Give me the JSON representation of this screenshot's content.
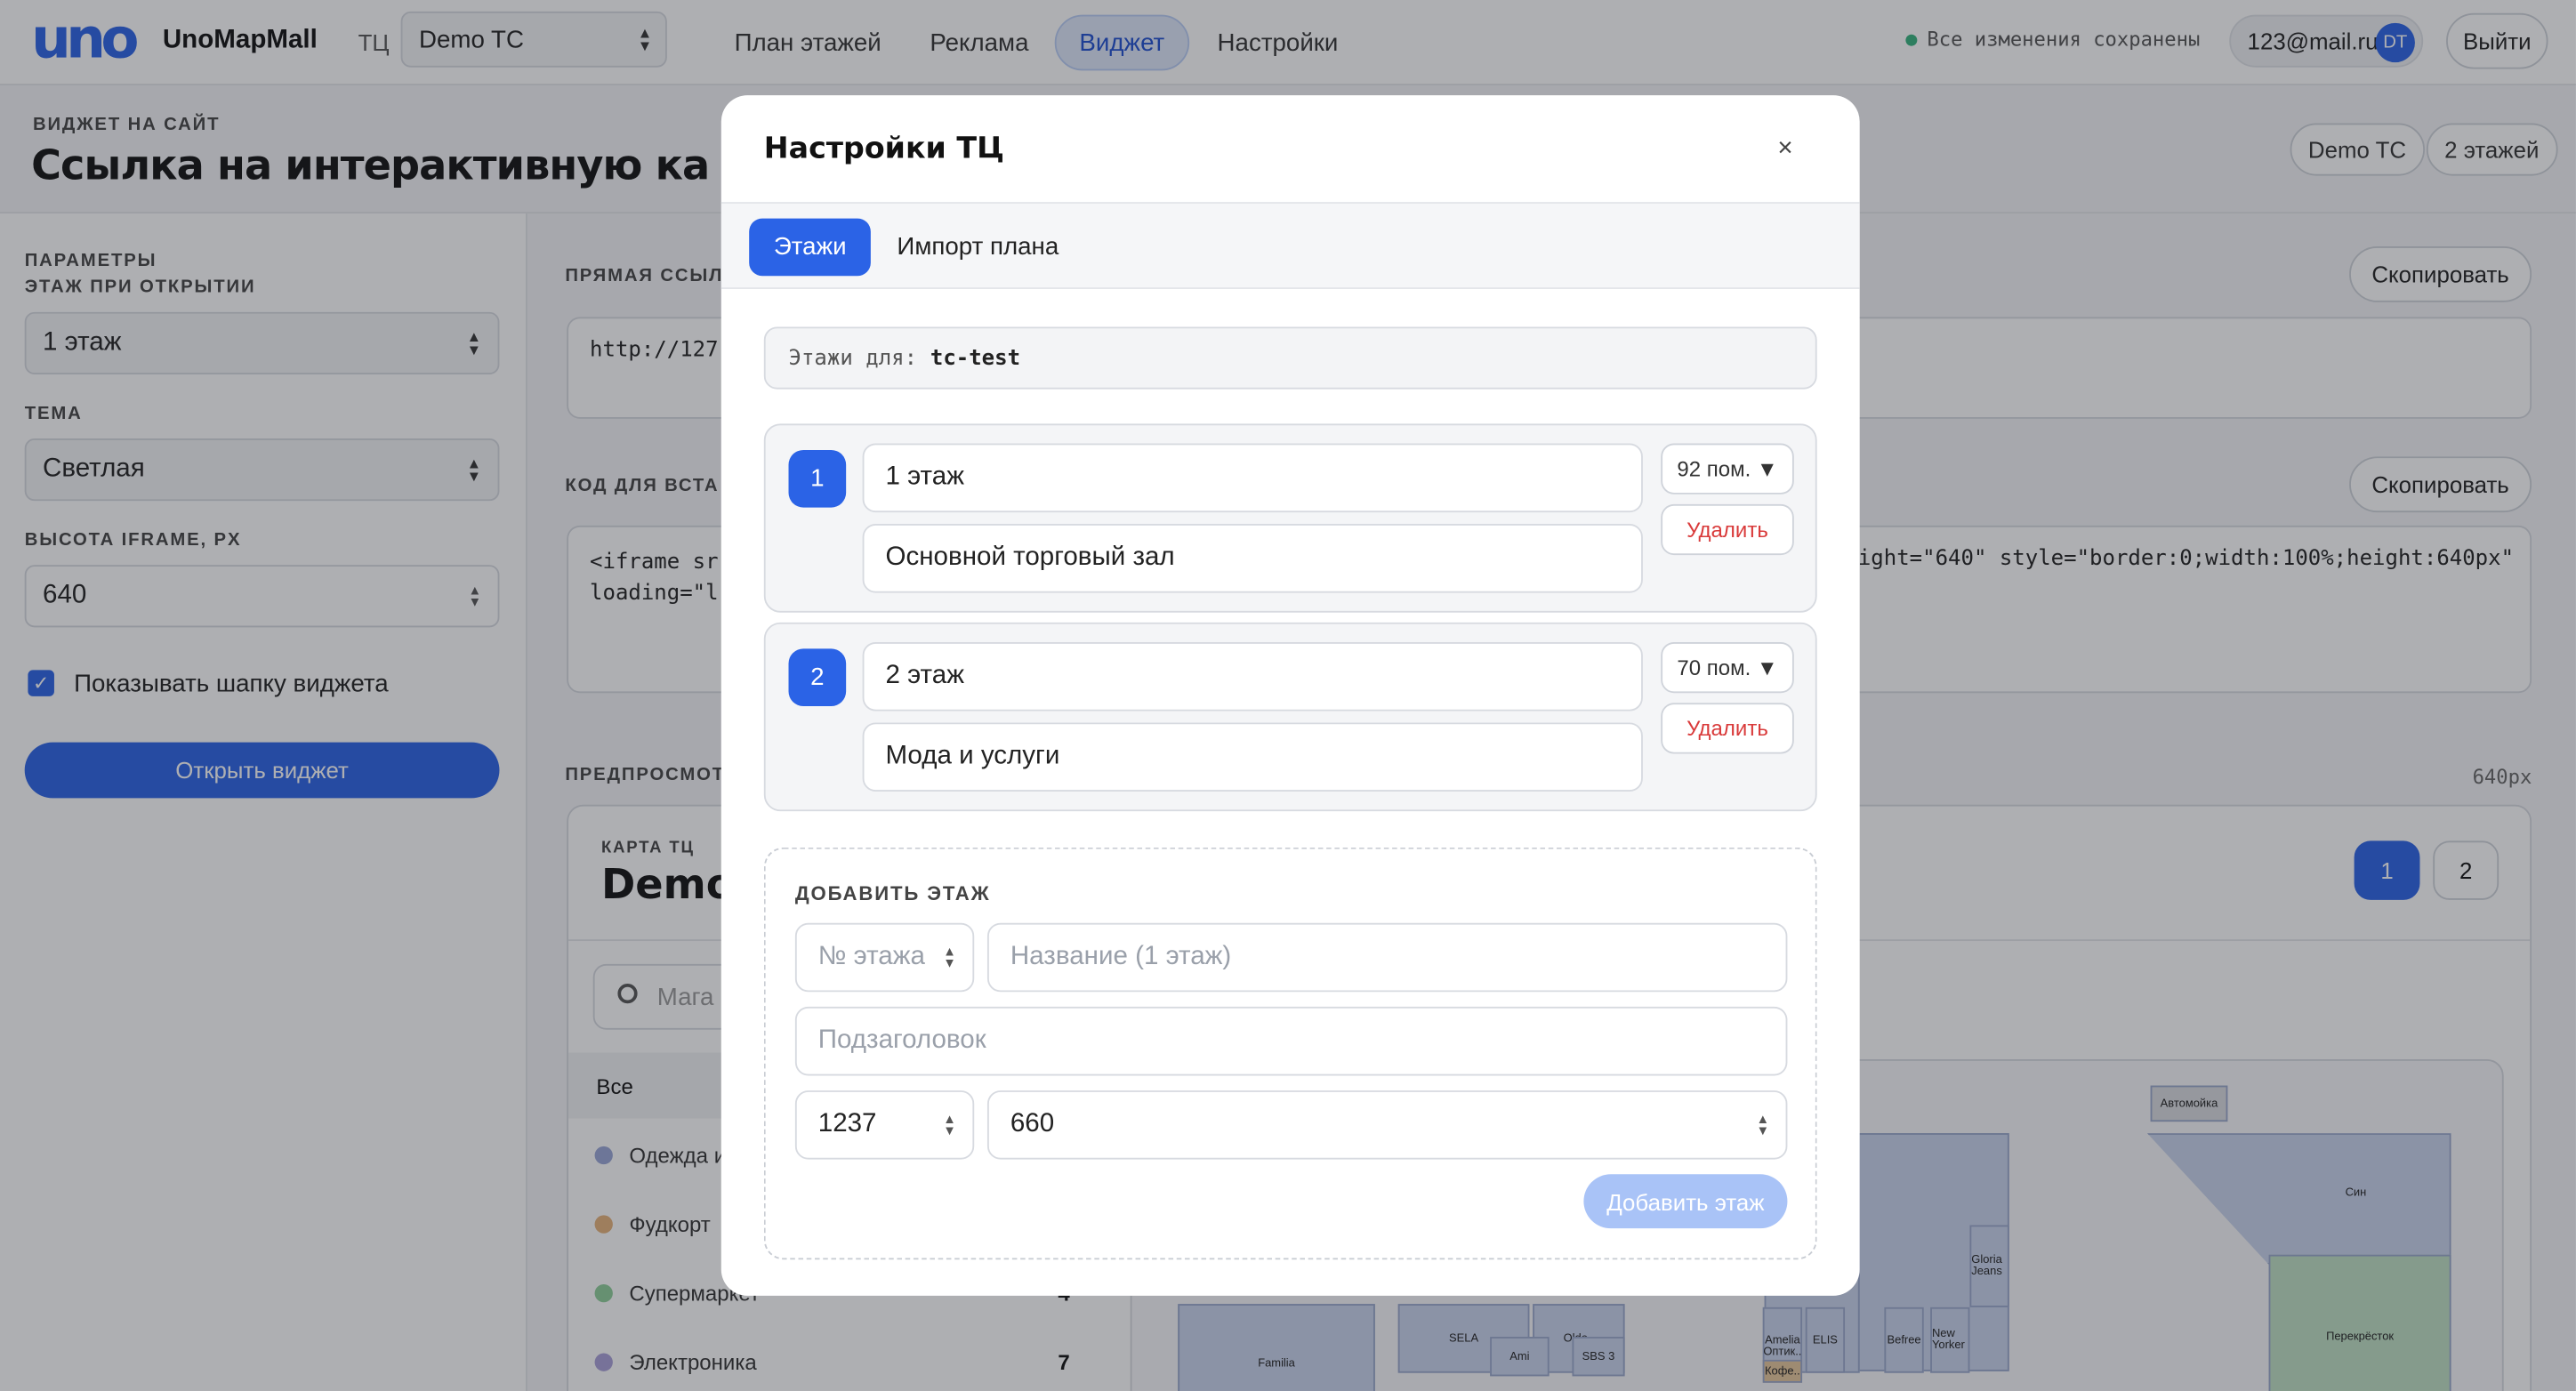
{
  "app": {
    "logo": "uno",
    "name": "UnoMapMall"
  },
  "topbar": {
    "tc_label": "ТЦ",
    "tc_select": "Demo TC",
    "nav": [
      "План этажей",
      "Реклама",
      "Виджет",
      "Настройки"
    ],
    "active_nav": "Виджет",
    "saved_status": "Все изменения сохранены",
    "user_email": "123@mail.ru",
    "avatar_initials": "DT",
    "logout": "Выйти"
  },
  "header": {
    "eyebrow": "ВИДЖЕТ НА САЙТ",
    "title": "Ссылка на интерактивную ка",
    "chip_tc": "Demo TC",
    "chip_floors": "2 этажей"
  },
  "params": {
    "section": "ПАРАМЕТРЫ",
    "floor_label": "ЭТАЖ ПРИ ОТКРЫТИИ",
    "floor_value": "1 этаж",
    "theme_label": "ТЕМА",
    "theme_value": "Светлая",
    "height_label": "ВЫСОТА IFRAME, PX",
    "height_value": "640",
    "show_header_label": "Показывать шапку виджета",
    "show_header_checked": true,
    "open_widget": "Открыть виджет"
  },
  "content": {
    "direct_link_label": "ПРЯМАЯ ССЫЛ",
    "direct_link_value": "http://127",
    "copy": "Скопировать",
    "embed_label": "КОД ДЛЯ ВСТА",
    "embed_line1_left": "<iframe sr",
    "embed_line2_left": "loading=\"l",
    "embed_line1_right": "ight=\"640\" style=\"border:0;width:100%;height:640px\"",
    "preview_label": "ПРЕДПРОСМОТ",
    "preview_px": "640px"
  },
  "preview": {
    "eyebrow": "КАРТА ТЦ",
    "title": "Demo",
    "search_placeholder": "Мага",
    "floors": [
      "1",
      "2"
    ],
    "category_all": "Все",
    "categories": [
      {
        "name": "Одежда и",
        "count": "",
        "color": "#9aa7d6"
      },
      {
        "name": "Фудкорт",
        "count": "",
        "color": "#e6b27a"
      },
      {
        "name": "Супермаркет",
        "count": "4",
        "color": "#8fcf9a"
      },
      {
        "name": "Электроника",
        "count": "7",
        "color": "#a9a0d8"
      }
    ],
    "map_labels": [
      "Автомойка",
      "Син",
      "Перекрёсток",
      "Familia",
      "SELA",
      "Oldo..",
      "Ami",
      "SBS 3",
      "Amelia",
      "ELIS",
      "Befree",
      "New Yorker",
      "Gloria Jeans",
      "Оптик..",
      "Кофе.."
    ]
  },
  "modal": {
    "title": "Настройки ТЦ",
    "close": "×",
    "tabs": [
      "Этажи",
      "Импорт плана"
    ],
    "for_label": "Этажи для:",
    "for_value": "tc-test",
    "floors": [
      {
        "num": "1",
        "name": "1 этаж",
        "subtitle": "Основной торговый зал",
        "rooms": "92 пом. ▼",
        "delete": "Удалить"
      },
      {
        "num": "2",
        "name": "2 этаж",
        "subtitle": "Мода и услуги",
        "rooms": "70 пом. ▼",
        "delete": "Удалить"
      }
    ],
    "add": {
      "heading": "ДОБАВИТЬ ЭТАЖ",
      "num_placeholder": "№ этажа",
      "name_placeholder": "Название (1 этаж)",
      "subtitle_placeholder": "Подзаголовок",
      "width_value": "1237",
      "height_value": "660",
      "submit": "Добавить этаж"
    }
  }
}
